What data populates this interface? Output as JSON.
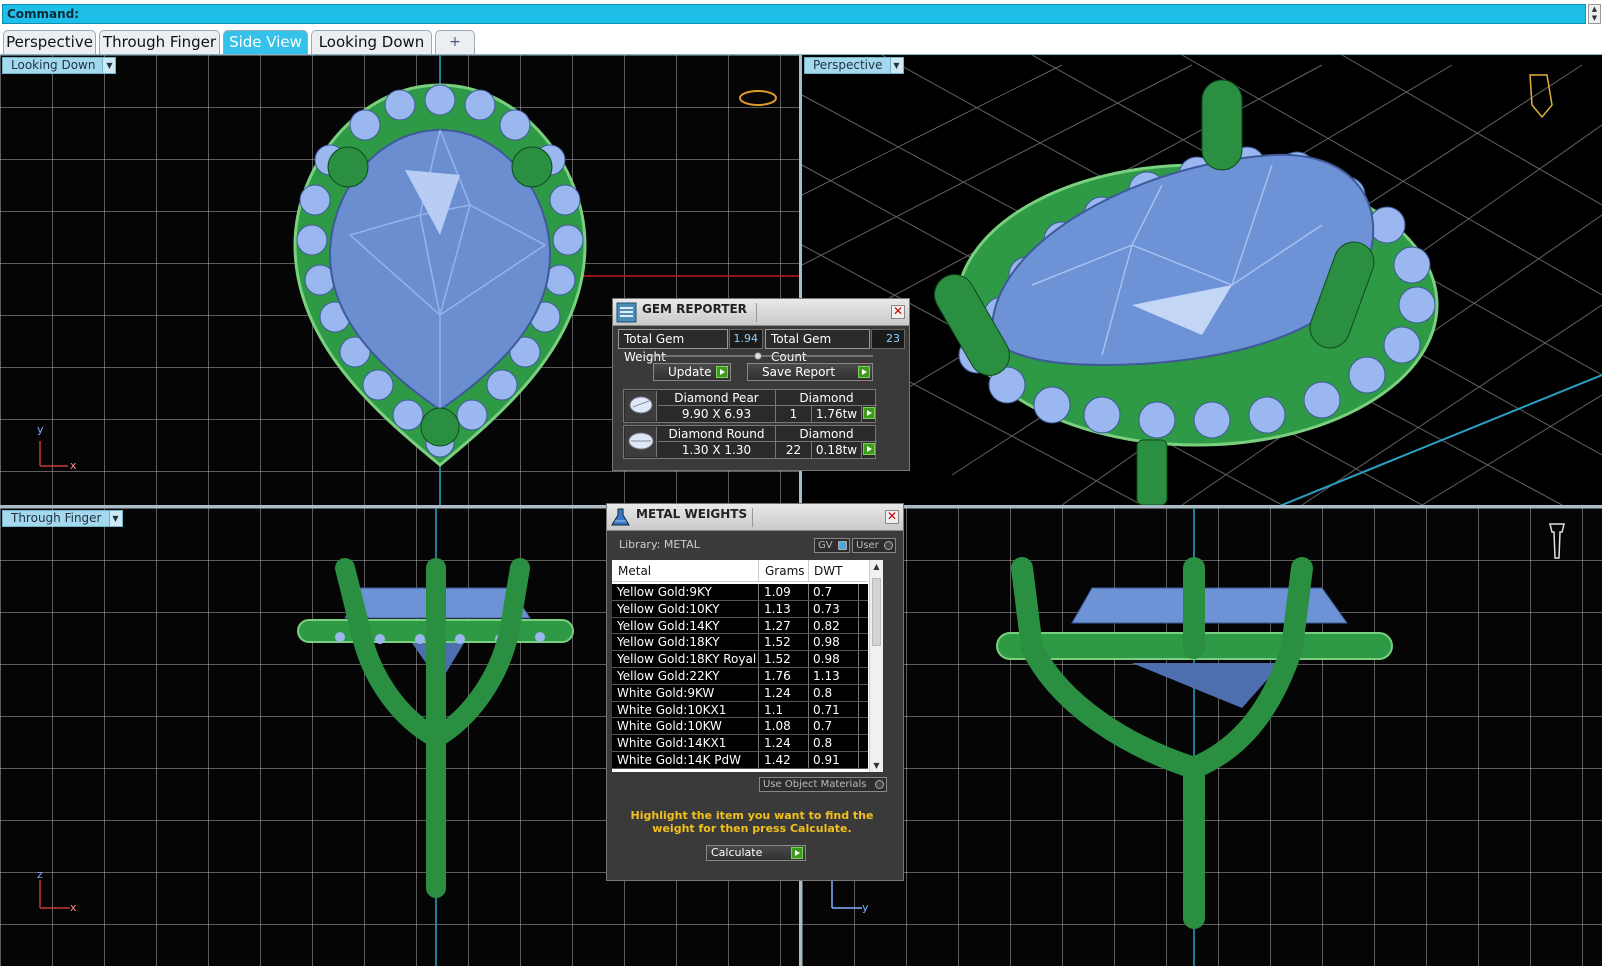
{
  "command": {
    "label": "Command:"
  },
  "tabs": [
    {
      "label": "Perspective"
    },
    {
      "label": "Through Finger"
    },
    {
      "label": "Side View"
    },
    {
      "label": "Looking Down"
    },
    {
      "label": "+"
    }
  ],
  "viewports": {
    "top_left": {
      "label": "Looking Down",
      "axis_v": "y",
      "axis_h": "x"
    },
    "top_right": {
      "label": "Perspective"
    },
    "bottom_left": {
      "label": "Through Finger",
      "axis_v": "z",
      "axis_h": "x"
    },
    "bottom_right": {
      "axis_v": "z",
      "axis_h": "y"
    }
  },
  "gem_reporter": {
    "title": "GEM REPORTER",
    "total_weight_label": "Total Gem Weight",
    "total_weight_value": "1.94",
    "total_count_label": "Total Gem Count",
    "total_count_value": "23",
    "update_label": "Update",
    "save_report_label": "Save Report",
    "gems": [
      {
        "name": "Diamond Pear",
        "material": "Diamond",
        "size": "9.90 X 6.93",
        "count": "1",
        "weight": "1.76tw"
      },
      {
        "name": "Diamond Round",
        "material": "Diamond",
        "size": "1.30 X 1.30",
        "count": "22",
        "weight": "0.18tw"
      }
    ]
  },
  "metal_weights": {
    "title": "METAL WEIGHTS",
    "library_label": "Library: METAL",
    "gv_label": "GV",
    "user_label": "User",
    "columns": [
      "Metal",
      "Grams",
      "DWT"
    ],
    "rows": [
      [
        "Yellow Gold:9KY",
        "1.09",
        "0.7"
      ],
      [
        "Yellow Gold:10KY",
        "1.13",
        "0.73"
      ],
      [
        "Yellow Gold:14KY",
        "1.27",
        "0.82"
      ],
      [
        "Yellow Gold:18KY",
        "1.52",
        "0.98"
      ],
      [
        "Yellow Gold:18KY Royal",
        "1.52",
        "0.98"
      ],
      [
        "Yellow Gold:22KY",
        "1.76",
        "1.13"
      ],
      [
        "White Gold:9KW",
        "1.24",
        "0.8"
      ],
      [
        "White Gold:10KX1",
        "1.1",
        "0.71"
      ],
      [
        "White Gold:10KW",
        "1.08",
        "0.7"
      ],
      [
        "White Gold:14KX1",
        "1.24",
        "0.8"
      ],
      [
        "White Gold:14K PdW",
        "1.42",
        "0.91"
      ]
    ],
    "use_object_materials_label": "Use Object Materials",
    "hint": "Highlight the item you want to find the weight for then press Calculate.",
    "calculate_label": "Calculate"
  },
  "colors": {
    "metal_green": "#2e9a45",
    "gem_blue": "#7d9fd6",
    "tab_active": "#35c2ea",
    "hint_yellow": "#f2c01d"
  }
}
